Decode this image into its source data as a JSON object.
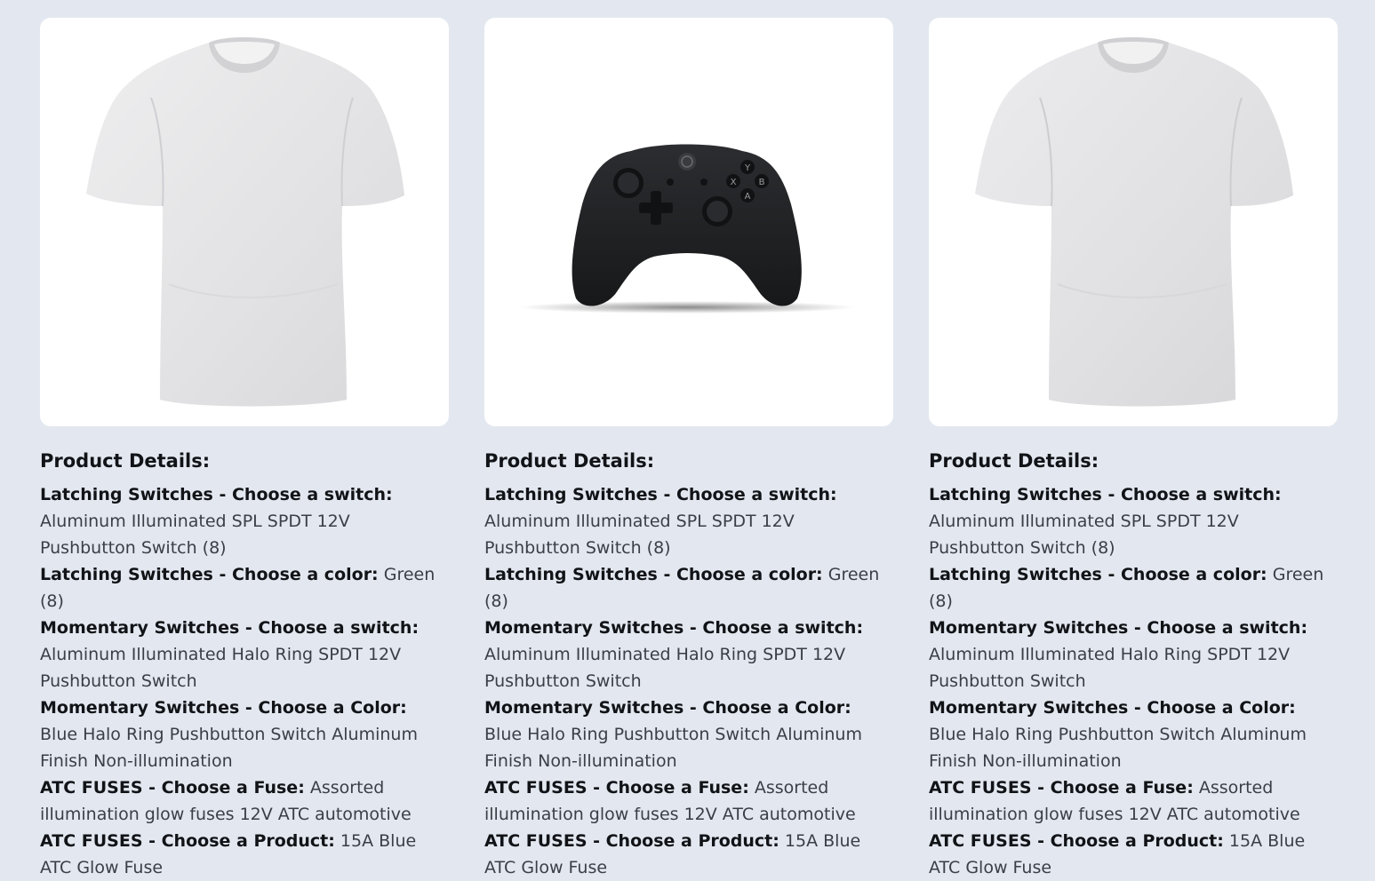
{
  "products": [
    {
      "image_alt": "white-tshirt",
      "heading": "Product Details:",
      "details": [
        {
          "label": "Latching Switches - Choose a switch:",
          "value": "Aluminum Illuminated SPL SPDT 12V Pushbutton Switch (8)"
        },
        {
          "label": "Latching Switches - Choose a color:",
          "value": "Green (8)"
        },
        {
          "label": "Momentary Switches - Choose a switch:",
          "value": "Aluminum Illuminated Halo Ring SPDT 12V Pushbutton Switch"
        },
        {
          "label": "Momentary Switches - Choose a Color:",
          "value": "Blue Halo Ring Pushbutton Switch Aluminum Finish Non-illumination"
        },
        {
          "label": "ATC FUSES - Choose a Fuse:",
          "value": "Assorted illumination glow fuses 12V ATC automotive"
        },
        {
          "label": "ATC FUSES - Choose a Product:",
          "value": "15A Blue ATC Glow Fuse"
        }
      ]
    },
    {
      "image_alt": "black-game-controller",
      "heading": "Product Details:",
      "details": [
        {
          "label": "Latching Switches - Choose a switch:",
          "value": "Aluminum Illuminated SPL SPDT 12V Pushbutton Switch (8)"
        },
        {
          "label": "Latching Switches - Choose a color:",
          "value": "Green (8)"
        },
        {
          "label": "Momentary Switches - Choose a switch:",
          "value": "Aluminum Illuminated Halo Ring SPDT 12V Pushbutton Switch"
        },
        {
          "label": "Momentary Switches - Choose a Color:",
          "value": "Blue Halo Ring Pushbutton Switch Aluminum Finish Non-illumination"
        },
        {
          "label": "ATC FUSES - Choose a Fuse:",
          "value": "Assorted illumination glow fuses 12V ATC automotive"
        },
        {
          "label": "ATC FUSES - Choose a Product:",
          "value": "15A Blue ATC Glow Fuse"
        }
      ]
    },
    {
      "image_alt": "white-tshirt",
      "heading": "Product Details:",
      "details": [
        {
          "label": "Latching Switches - Choose a switch:",
          "value": "Aluminum Illuminated SPL SPDT 12V Pushbutton Switch (8)"
        },
        {
          "label": "Latching Switches - Choose a color:",
          "value": "Green (8)"
        },
        {
          "label": "Momentary Switches - Choose a switch:",
          "value": "Aluminum Illuminated Halo Ring SPDT 12V Pushbutton Switch"
        },
        {
          "label": "Momentary Switches - Choose a Color:",
          "value": "Blue Halo Ring Pushbutton Switch Aluminum Finish Non-illumination"
        },
        {
          "label": "ATC FUSES - Choose a Fuse:",
          "value": "Assorted illumination glow fuses 12V ATC automotive"
        },
        {
          "label": "ATC FUSES - Choose a Product:",
          "value": "15A Blue ATC Glow Fuse"
        }
      ]
    }
  ],
  "controller_buttons": {
    "y": "Y",
    "x": "X",
    "b": "B",
    "a": "A"
  },
  "colors": {
    "page_background": "#e3e8f0",
    "card_background": "#ffffff",
    "shirt": "#e4e4e6",
    "controller": "#1e1f21"
  }
}
